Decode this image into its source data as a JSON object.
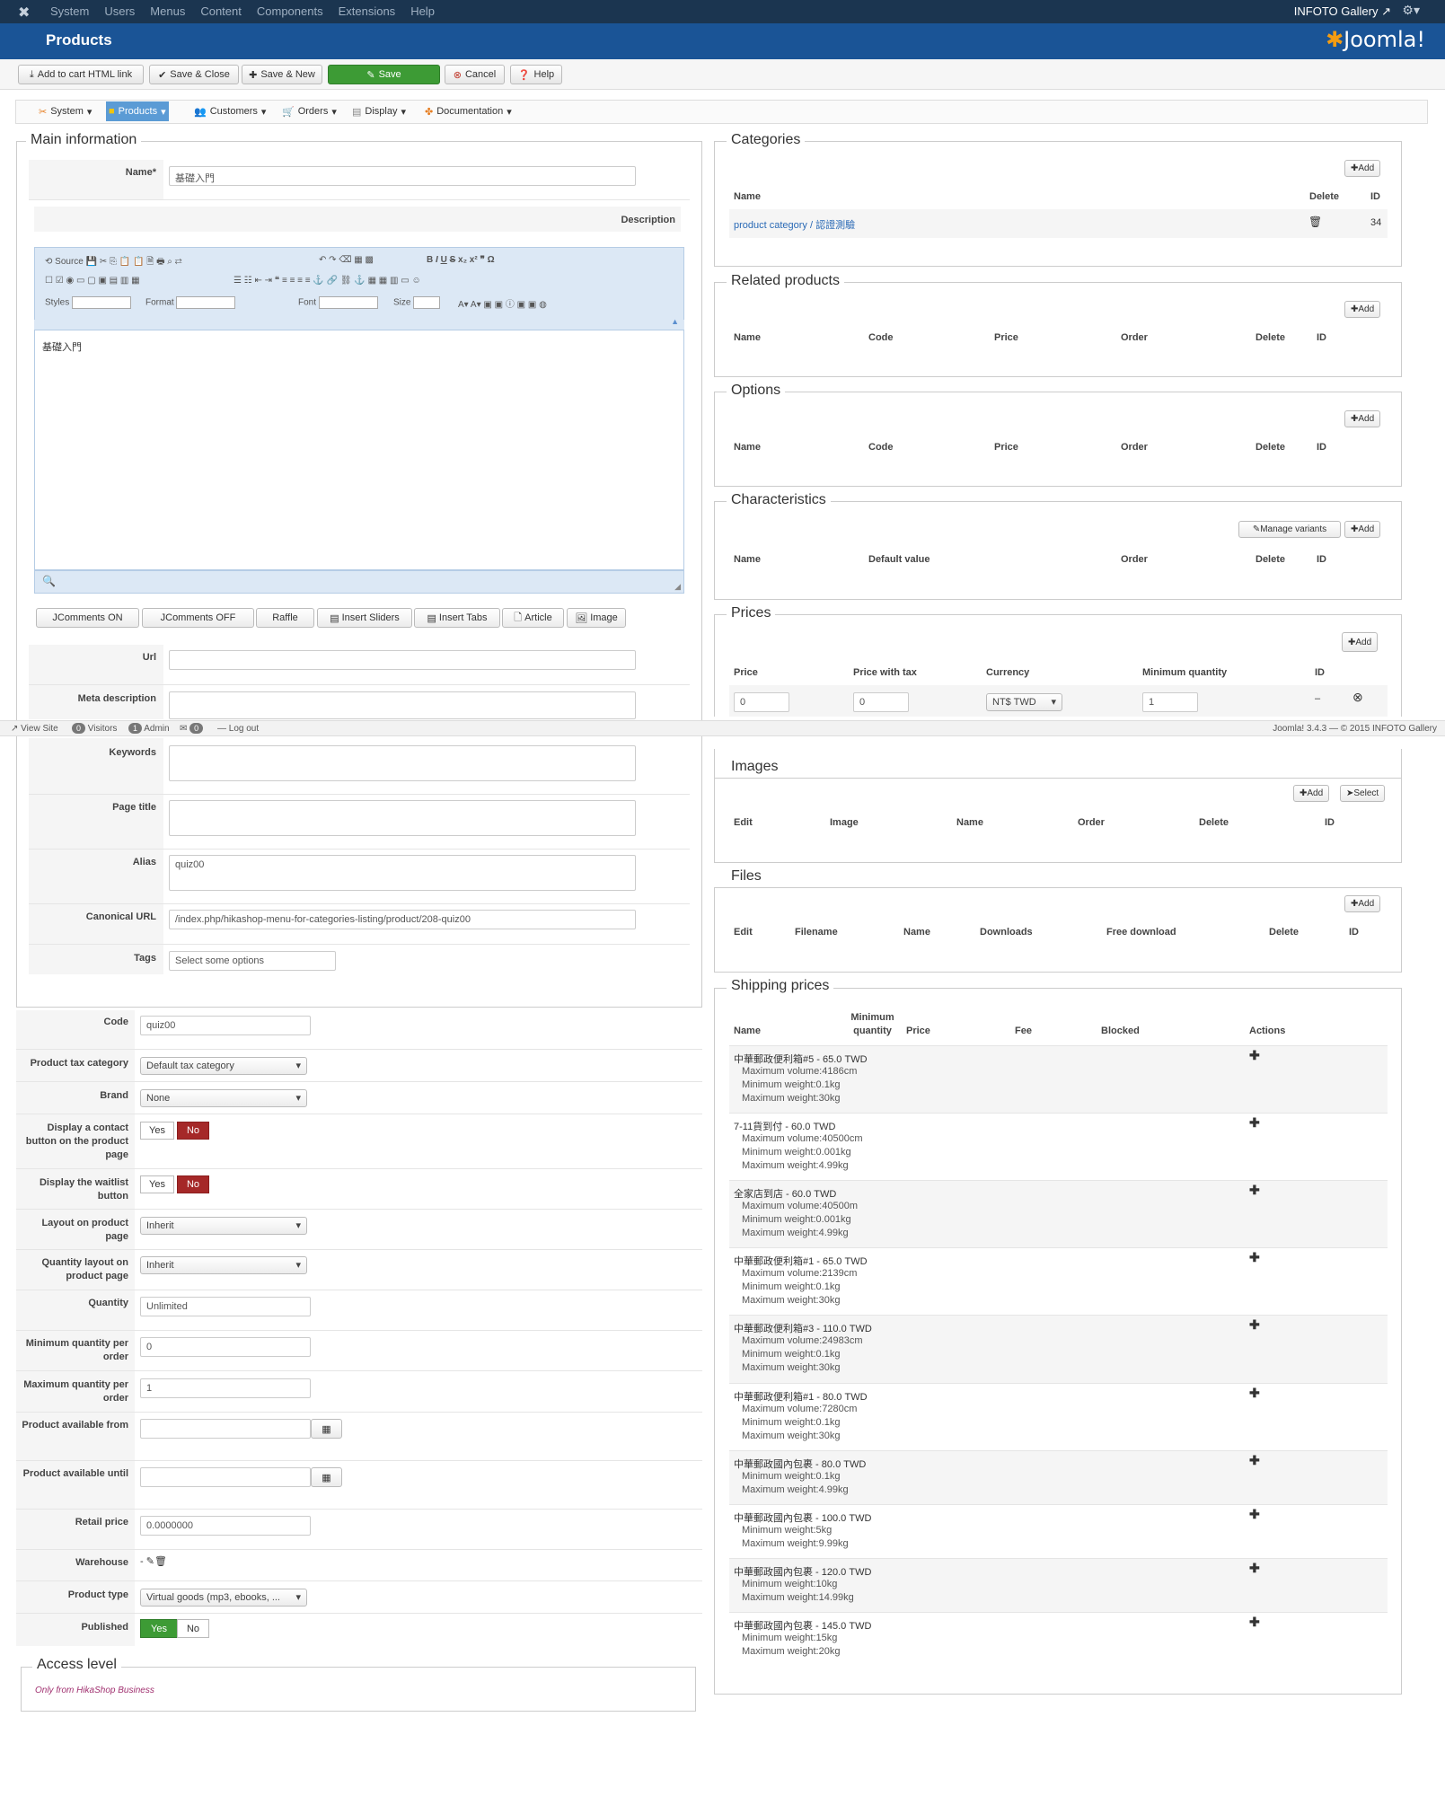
{
  "topnav": {
    "items": [
      "System",
      "Users",
      "Menus",
      "Content",
      "Components",
      "Extensions",
      "Help"
    ],
    "site": "INFOTO Gallery"
  },
  "titlebar": {
    "title": "Products",
    "brand": "Joomla!"
  },
  "toolbar": {
    "add_cart": "Add to cart HTML link",
    "save_close": "Save & Close",
    "save_new": "Save & New",
    "save": "Save",
    "cancel": "Cancel",
    "help": "Help"
  },
  "hsmenu": [
    "System",
    "Products",
    "Customers",
    "Orders",
    "Display",
    "Documentation"
  ],
  "main": {
    "title": "Main information",
    "name_label": "Name*",
    "name_value": "基礎入門",
    "description_label": "Description",
    "editor_text": "基礎入門",
    "editor": {
      "source": "Source",
      "styles": "Styles",
      "format": "Format",
      "font": "Font",
      "size": "Size"
    },
    "plugin_buttons": [
      "JComments ON",
      "JComments OFF",
      "Raffle",
      "Insert Sliders",
      "Insert Tabs",
      "Article",
      "Image"
    ],
    "url_label": "Url",
    "meta_label": "Meta description",
    "keywords_label": "Keywords",
    "page_title_label": "Page title",
    "alias_label": "Alias",
    "alias_value": "quiz00",
    "canonical_label": "Canonical URL",
    "canonical_value": "/index.php/hikashop-menu-for-categories-listing/product/208-quiz00",
    "tags_label": "Tags",
    "tags_placeholder": "Select some options"
  },
  "statusbar": {
    "view_site": "View Site",
    "visitors_count": "0",
    "visitors": "Visitors",
    "admin_count": "1",
    "admin": "Admin",
    "msg_count": "0",
    "logout": "Log out",
    "version": "Joomla! 3.4.3 — © 2015 INFOTO Gallery"
  },
  "details": {
    "code_label": "Code",
    "code_value": "quiz00",
    "tax_label": "Product tax category",
    "tax_value": "Default tax category",
    "brand_label": "Brand",
    "brand_value": "None",
    "contact_label": "Display a contact button on the product page",
    "waitlist_label": "Display the waitlist button",
    "yes": "Yes",
    "no": "No",
    "layout_label": "Layout on product page",
    "layout_value": "Inherit",
    "qlayout_label": "Quantity layout on product page",
    "qlayout_value": "Inherit",
    "quantity_label": "Quantity",
    "quantity_placeholder": "Unlimited",
    "minq_label": "Minimum quantity per order",
    "minq_value": "0",
    "maxq_label": "Maximum quantity per order",
    "maxq_value": "1",
    "avail_from_label": "Product available from",
    "avail_until_label": "Product available until",
    "retail_label": "Retail price",
    "retail_value": "0.0000000",
    "warehouse_label": "Warehouse",
    "warehouse_value": "-",
    "type_label": "Product type",
    "type_value": "Virtual goods (mp3, ebooks, ...",
    "published_label": "Published"
  },
  "access": {
    "title": "Access level",
    "note": "Only from HikaShop Business"
  },
  "categories": {
    "title": "Categories",
    "add": "Add",
    "cols": [
      "Name",
      "Delete",
      "ID"
    ],
    "row_link1": "product category",
    "row_sep": " / ",
    "row_link2": "認證測驗",
    "row_id": "34"
  },
  "related": {
    "title": "Related products",
    "add": "Add",
    "cols": [
      "Name",
      "Code",
      "Price",
      "Order",
      "Delete",
      "ID"
    ]
  },
  "options": {
    "title": "Options",
    "add": "Add",
    "cols": [
      "Name",
      "Code",
      "Price",
      "Order",
      "Delete",
      "ID"
    ]
  },
  "characteristics": {
    "title": "Characteristics",
    "manage": "Manage variants",
    "add": "Add",
    "cols": [
      "Name",
      "Default value",
      "Order",
      "Delete",
      "ID"
    ]
  },
  "prices": {
    "title": "Prices",
    "add": "Add",
    "cols": [
      "Price",
      "Price with tax",
      "Currency",
      "Minimum quantity",
      "ID"
    ],
    "price": "0",
    "price_tax": "0",
    "currency": "NT$ TWD",
    "minq": "1",
    "id": "–"
  },
  "images": {
    "title": "Images",
    "add": "Add",
    "select": "Select",
    "cols": [
      "Edit",
      "Image",
      "Name",
      "Order",
      "Delete",
      "ID"
    ]
  },
  "files": {
    "title": "Files",
    "add": "Add",
    "cols": [
      "Edit",
      "Filename",
      "Name",
      "Downloads",
      "Free download",
      "Delete",
      "ID"
    ]
  },
  "shipping": {
    "title": "Shipping prices",
    "cols": [
      "Name",
      "Minimum quantity",
      "Price",
      "Fee",
      "Blocked",
      "Actions"
    ],
    "rows": [
      {
        "name": "中華郵政便利箱#5 - 65.0 TWD",
        "details": [
          "Maximum volume:4186cm",
          "Minimum weight:0.1kg",
          "Maximum weight:30kg"
        ]
      },
      {
        "name": "7-11貨到付 - 60.0 TWD",
        "details": [
          "Maximum volume:40500cm",
          "Minimum weight:0.001kg",
          "Maximum weight:4.99kg"
        ]
      },
      {
        "name": "全家店到店 - 60.0 TWD",
        "details": [
          "Maximum volume:40500m",
          "Minimum weight:0.001kg",
          "Maximum weight:4.99kg"
        ]
      },
      {
        "name": "中華郵政便利箱#1 - 65.0 TWD",
        "details": [
          "Maximum volume:2139cm",
          "Minimum weight:0.1kg",
          "Maximum weight:30kg"
        ]
      },
      {
        "name": "中華郵政便利箱#3 - 110.0 TWD",
        "details": [
          "Maximum volume:24983cm",
          "Minimum weight:0.1kg",
          "Maximum weight:30kg"
        ]
      },
      {
        "name": "中華郵政便利箱#1 - 80.0 TWD",
        "details": [
          "Maximum volume:7280cm",
          "Minimum weight:0.1kg",
          "Maximum weight:30kg"
        ]
      },
      {
        "name": "中華郵政國內包裹 - 80.0 TWD",
        "details": [
          "Minimum weight:0.1kg",
          "Maximum weight:4.99kg"
        ]
      },
      {
        "name": "中華郵政國內包裹 - 100.0 TWD",
        "details": [
          "Minimum weight:5kg",
          "Maximum weight:9.99kg"
        ]
      },
      {
        "name": "中華郵政國內包裹 - 120.0 TWD",
        "details": [
          "Minimum weight:10kg",
          "Maximum weight:14.99kg"
        ]
      },
      {
        "name": "中華郵政國內包裹 - 145.0 TWD",
        "details": [
          "Minimum weight:15kg",
          "Maximum weight:20kg"
        ]
      }
    ]
  }
}
